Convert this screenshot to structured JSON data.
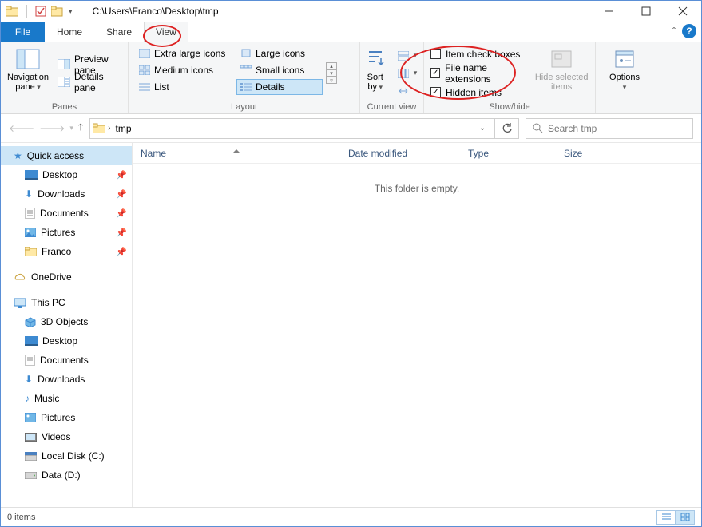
{
  "window": {
    "title": "C:\\Users\\Franco\\Desktop\\tmp"
  },
  "tabs": {
    "file": "File",
    "home": "Home",
    "share": "Share",
    "view": "View"
  },
  "ribbon": {
    "panes": {
      "navigation": "Navigation pane",
      "preview": "Preview pane",
      "details": "Details pane",
      "group_label": "Panes"
    },
    "layout": {
      "xlarge": "Extra large icons",
      "large": "Large icons",
      "medium": "Medium icons",
      "small": "Small icons",
      "list": "List",
      "details": "Details",
      "group_label": "Layout"
    },
    "current_view": {
      "sort_by": "Sort by",
      "group_label": "Current view"
    },
    "show_hide": {
      "item_check_boxes": "Item check boxes",
      "file_name_ext": "File name extensions",
      "hidden_items": "Hidden items",
      "hide_selected": "Hide selected items",
      "group_label": "Show/hide"
    },
    "options": "Options"
  },
  "address": {
    "crumb": "tmp",
    "search_placeholder": "Search tmp"
  },
  "columns": {
    "name": "Name",
    "date_modified": "Date modified",
    "type": "Type",
    "size": "Size"
  },
  "content": {
    "empty": "This folder is empty."
  },
  "tree": {
    "quick_access": "Quick access",
    "desktop": "Desktop",
    "downloads": "Downloads",
    "documents": "Documents",
    "pictures": "Pictures",
    "franco": "Franco",
    "onedrive": "OneDrive",
    "this_pc": "This PC",
    "objects3d": "3D Objects",
    "desktop2": "Desktop",
    "documents2": "Documents",
    "downloads2": "Downloads",
    "music": "Music",
    "pictures2": "Pictures",
    "videos": "Videos",
    "local_disk": "Local Disk (C:)",
    "data_d": "Data (D:)"
  },
  "status": {
    "items": "0 items"
  },
  "checks": {
    "item_check_boxes": false,
    "file_name_ext": true,
    "hidden_items": true
  }
}
